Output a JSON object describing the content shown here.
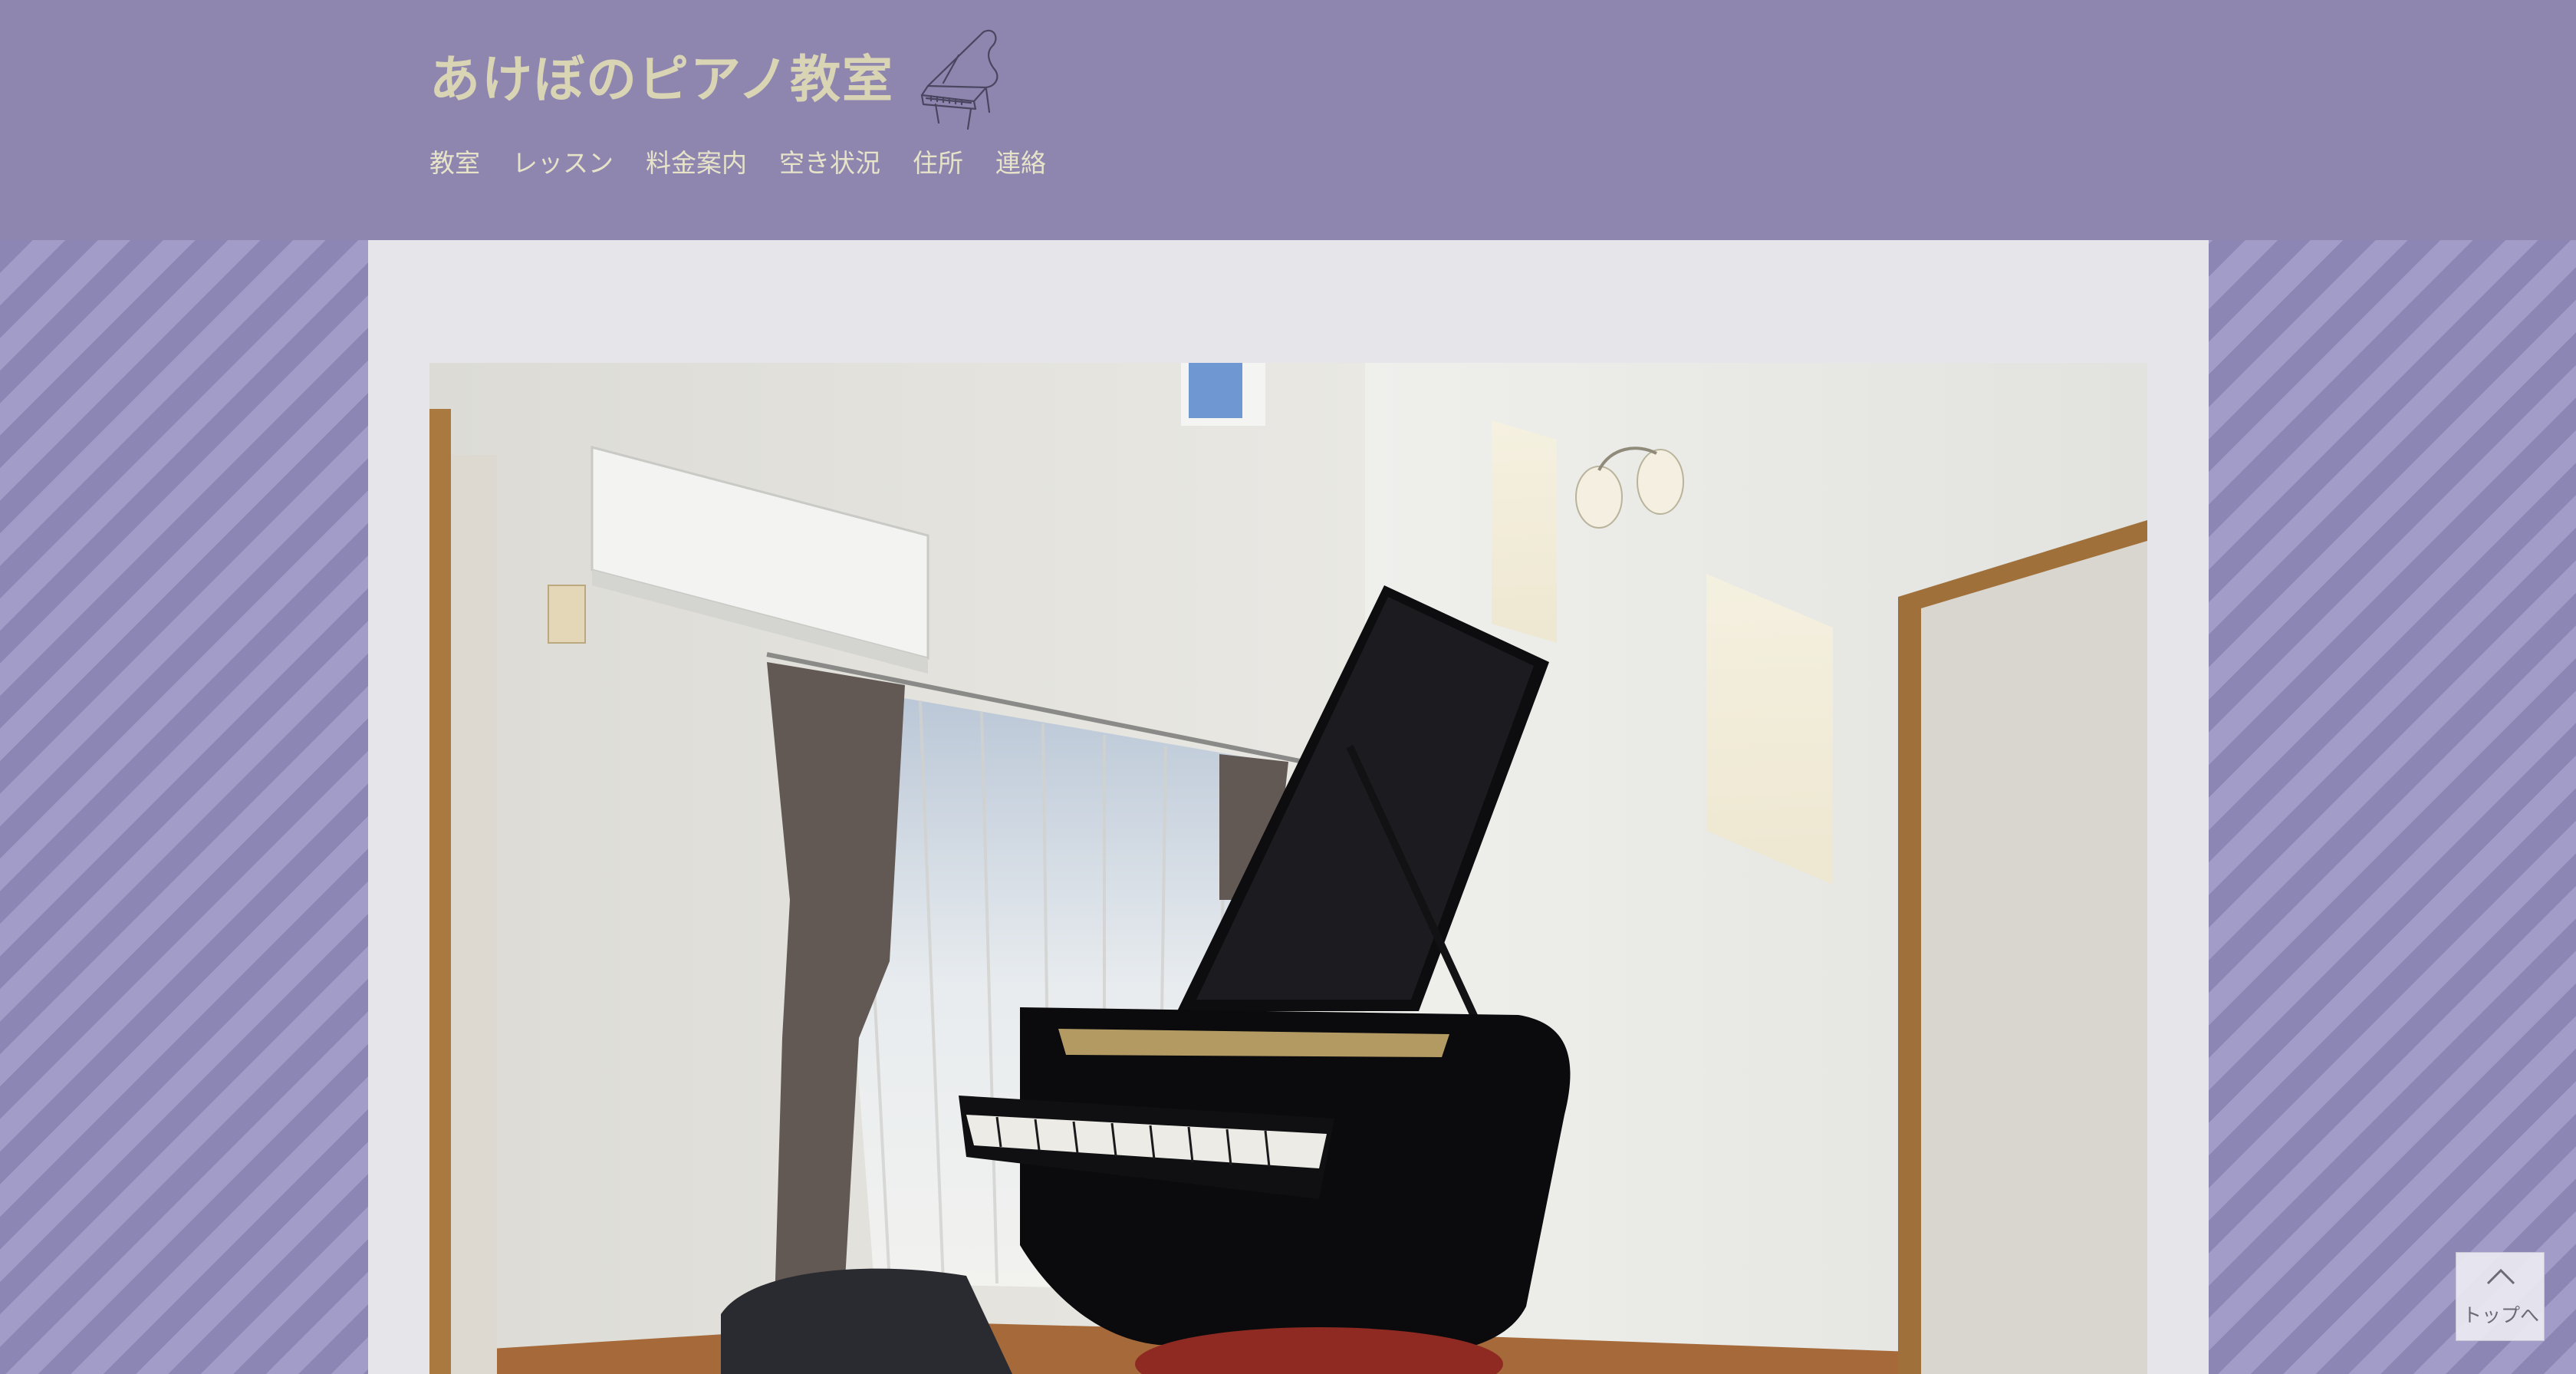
{
  "site": {
    "title": "あけぼのピアノ教室",
    "logo_icon": "grand-piano-sketch-icon"
  },
  "nav": {
    "items": [
      "教室",
      "レッスン",
      "料金案内",
      "空き状況",
      "住所",
      "連絡"
    ]
  },
  "hero": {
    "image": "grand-piano-room-photo"
  },
  "to_top": {
    "label": "トップへ",
    "icon": "chevron-up-icon"
  },
  "colors": {
    "header_bg": "#8f86b0",
    "title_text": "#d9d5b4",
    "nav_text": "#e6e3c9",
    "stripe_light": "#a19cc8",
    "stripe_dark": "#8b86b4",
    "panel_bg": "#e6e5ea"
  }
}
